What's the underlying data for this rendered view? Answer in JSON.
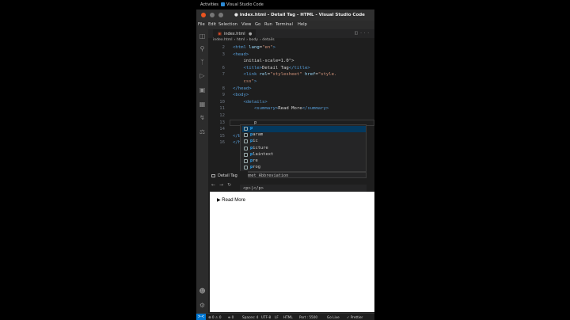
{
  "topbar": {
    "activities": "Activities",
    "app_name": "Visual Studio Code"
  },
  "titlebar": {
    "title": "● index.html - Detail Tag - HTML - Visual Studio Code"
  },
  "menu": [
    "File",
    "Edit",
    "Selection",
    "View",
    "Go",
    "Run",
    "Terminal",
    "Help"
  ],
  "tab": {
    "label": "index.html",
    "icon": "html-file-icon"
  },
  "breadcrumbs": [
    "index.html",
    "html",
    "body",
    "details"
  ],
  "code_lines": [
    {
      "num": "2",
      "tokens": [
        [
          "tag",
          "<html "
        ],
        [
          "attr",
          "lang"
        ],
        [
          "txt",
          "="
        ],
        [
          "str",
          "\"en\""
        ],
        [
          "tag",
          ">"
        ]
      ]
    },
    {
      "num": "3",
      "tokens": [
        [
          "tag",
          "<head>"
        ]
      ]
    },
    {
      "num": "",
      "tokens": [
        [
          "txt",
          "    initial-scale=1.0\">"
        ]
      ]
    },
    {
      "num": "6",
      "tokens": [
        [
          "tag",
          "    <title>"
        ],
        [
          "txt",
          "Detail Tag"
        ],
        [
          "tag",
          "</title>"
        ]
      ]
    },
    {
      "num": "7",
      "tokens": [
        [
          "tag",
          "    <link "
        ],
        [
          "attr",
          "rel"
        ],
        [
          "txt",
          "="
        ],
        [
          "str",
          "\"stylesheet\""
        ],
        [
          "attr",
          " href"
        ],
        [
          "txt",
          "="
        ],
        [
          "str",
          "\"style."
        ]
      ]
    },
    {
      "num": "",
      "tokens": [
        [
          "str",
          "    css\""
        ],
        [
          "tag",
          ">"
        ]
      ]
    },
    {
      "num": "8",
      "tokens": [
        [
          "tag",
          "</head>"
        ]
      ]
    },
    {
      "num": "9",
      "tokens": [
        [
          "tag",
          "<body>"
        ]
      ]
    },
    {
      "num": "10",
      "tokens": [
        [
          "tag",
          "    <details>"
        ]
      ]
    },
    {
      "num": "11",
      "tokens": [
        [
          "tag",
          "        <summary>"
        ],
        [
          "txt",
          "Read More"
        ],
        [
          "tag",
          "</summary>"
        ]
      ]
    },
    {
      "num": "12",
      "tokens": []
    },
    {
      "num": "13",
      "tokens": [
        [
          "txt",
          "        p"
        ]
      ]
    },
    {
      "num": "14",
      "tokens": [
        [
          "tag",
          "    </d"
        ]
      ]
    },
    {
      "num": "15",
      "tokens": [
        [
          "tag",
          "</b"
        ]
      ]
    },
    {
      "num": "16",
      "tokens": [
        [
          "tag",
          "</h"
        ]
      ]
    }
  ],
  "suggestions": [
    {
      "prefix": "p",
      "rest": ""
    },
    {
      "prefix": "p",
      "rest": "aram"
    },
    {
      "prefix": "p",
      "rest": "ic"
    },
    {
      "prefix": "p",
      "rest": "icture"
    },
    {
      "prefix": "p",
      "rest": "laintext"
    },
    {
      "prefix": "p",
      "rest": "re"
    },
    {
      "prefix": "p",
      "rest": "rog"
    }
  ],
  "emmet": "Emmet Abbreviation",
  "emmet_preview": "<p>|</p>",
  "simple_browser": {
    "tab_label": "Detail Tag",
    "summary": "Read More"
  },
  "status": {
    "remote": "><",
    "problems": "⊗ 0  ⚠ 0",
    "ports": "⛯ 0",
    "spaces": "Spaces: 4",
    "encoding": "UTF-8",
    "eol": "LF",
    "language": "HTML",
    "port": "Port : 5500",
    "golive": "Go Live",
    "prettier": "✓ Prettier"
  }
}
